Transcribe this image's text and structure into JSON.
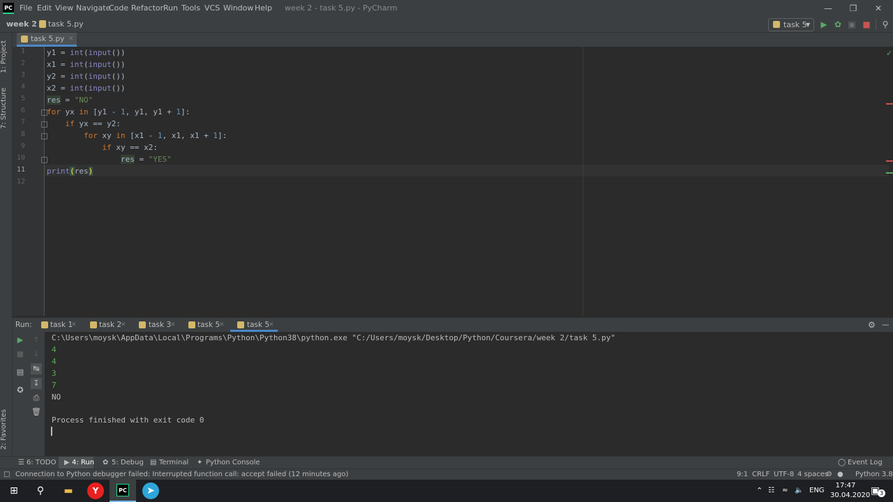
{
  "titlebar": {
    "menu": [
      "File",
      "Edit",
      "View",
      "Navigate",
      "Code",
      "Refactor",
      "Run",
      "Tools",
      "VCS",
      "Window",
      "Help"
    ],
    "window_title": "week 2 - task 5.py - PyCharm",
    "logo_text": "PC"
  },
  "navbar": {
    "project": "week 2",
    "file": "task 5.py",
    "run_config": "task 5"
  },
  "left_strip": {
    "project_tab": "1: Project",
    "structure_tab": "7: Structure",
    "favorites_tab": "2: Favorites"
  },
  "editor": {
    "tab_label": "task 5.py",
    "line_numbers": [
      "1",
      "2",
      "3",
      "4",
      "5",
      "6",
      "7",
      "8",
      "9",
      "10",
      "11",
      "12"
    ],
    "current_line": "11"
  },
  "run_panel": {
    "label": "Run:",
    "tabs": [
      "task 1",
      "task 2",
      "task 3",
      "task 5",
      "task 5"
    ],
    "output": {
      "command": "C:\\Users\\moysk\\AppData\\Local\\Programs\\Python\\Python38\\python.exe \"C:/Users/moysk/Desktop/Python/Coursera/week 2/task 5.py\"",
      "inputs": [
        "4",
        "4",
        "3",
        "7"
      ],
      "result": "NO",
      "finished": "Process finished with exit code 0"
    }
  },
  "tooltabs": {
    "todo": "6: TODO",
    "run": "4: Run",
    "debug": "5: Debug",
    "terminal": "Terminal",
    "python_console": "Python Console",
    "event_log": "Event Log"
  },
  "statusbar": {
    "message": "Connection to Python debugger failed: Interrupted function call: accept failed (12 minutes ago)",
    "position": "9:1",
    "line_sep": "CRLF",
    "encoding": "UTF-8",
    "indent": "4 spaces",
    "interpreter": "Python 3.8"
  },
  "taskbar": {
    "lang": "ENG",
    "time": "17:47",
    "date": "30.04.2020",
    "notif_count": "3"
  },
  "colors": {
    "keyword": "#cc7832",
    "builtin": "#8888c6",
    "string": "#6a8759",
    "number": "#6897bb",
    "accent": "#4a88c7"
  }
}
